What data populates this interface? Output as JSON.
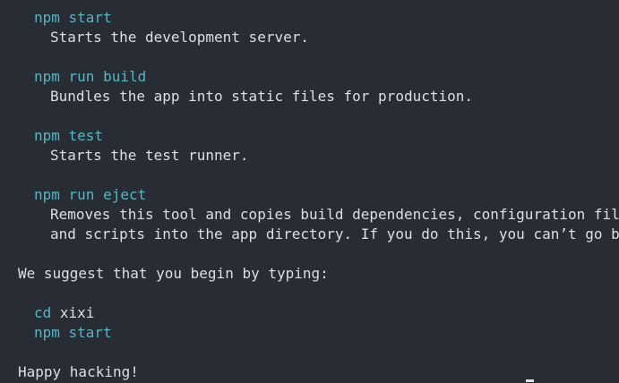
{
  "terminal": {
    "scripts": [
      {
        "command": "npm start",
        "description": [
          "Starts the development server."
        ]
      },
      {
        "command": "npm run build",
        "description": [
          "Bundles the app into static files for production."
        ]
      },
      {
        "command": "npm test",
        "description": [
          "Starts the test runner."
        ]
      },
      {
        "command": "npm run eject",
        "description": [
          "Removes this tool and copies build dependencies, configuration files",
          "and scripts into the app directory. If you do this, you can’t go back!"
        ]
      }
    ],
    "suggestion": "We suggest that you begin by typing:",
    "next_steps": [
      {
        "cmd": "cd",
        "arg": " xixi"
      },
      {
        "cmd": "npm start",
        "arg": ""
      }
    ],
    "farewell": "Happy hacking!",
    "colors": {
      "background": "#282c34",
      "command": "#56b6c2",
      "text": "#dcdfe4"
    }
  }
}
